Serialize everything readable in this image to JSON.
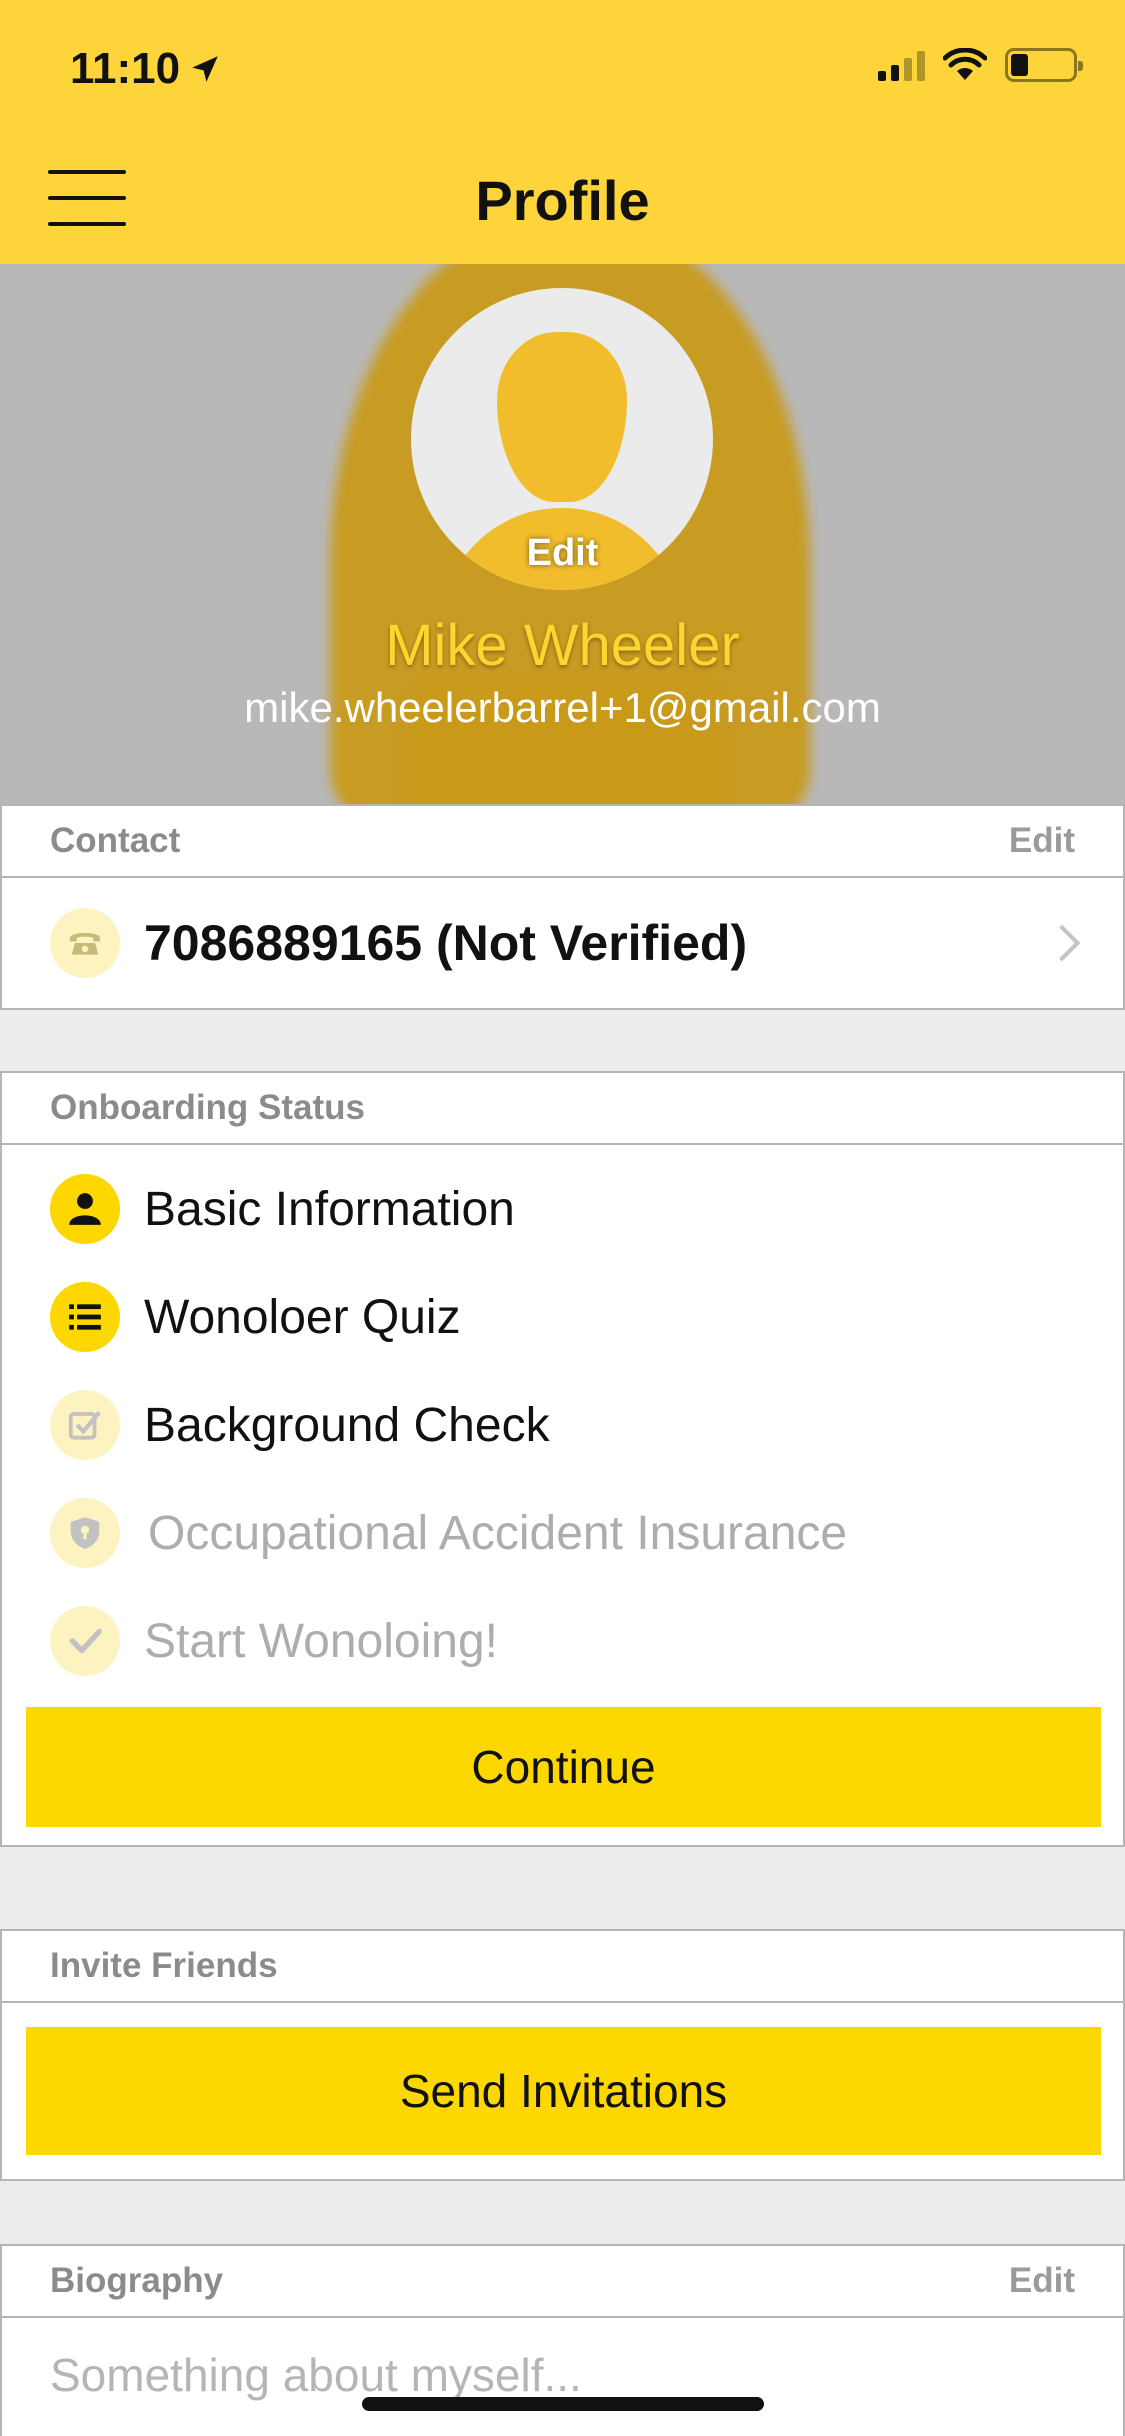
{
  "status_bar": {
    "time": "11:10",
    "location_icon": "location-arrow-icon",
    "battery_level": 0.28
  },
  "nav": {
    "title": "Profile",
    "menu_icon": "hamburger-menu-icon"
  },
  "profile": {
    "avatar_edit_label": "Edit",
    "name": "Mike Wheeler",
    "email": "mike.wheelerbarrel+1@gmail.com"
  },
  "contact": {
    "header": "Contact",
    "edit_label": "Edit",
    "phone": "7086889165 (Not Verified)",
    "phone_icon": "phone-icon"
  },
  "onboarding": {
    "header": "Onboarding Status",
    "items": [
      {
        "label": "Basic Information",
        "icon": "person-icon",
        "state": "complete"
      },
      {
        "label": "Wonoloer Quiz",
        "icon": "list-icon",
        "state": "complete"
      },
      {
        "label": "Background Check",
        "icon": "checkbox-icon",
        "state": "current"
      },
      {
        "label": "Occupational Accident Insurance",
        "icon": "shield-icon",
        "state": "pending"
      },
      {
        "label": "Start Wonoloing!",
        "icon": "checkmark-icon",
        "state": "pending"
      }
    ],
    "continue_label": "Continue"
  },
  "invite": {
    "header": "Invite Friends",
    "button_label": "Send Invitations"
  },
  "biography": {
    "header": "Biography",
    "edit_label": "Edit",
    "placeholder": "Something about myself..."
  },
  "colors": {
    "brand_yellow": "#fdd700",
    "topbar_yellow": "#fdd53a",
    "muted_text": "#8b8b8b"
  }
}
